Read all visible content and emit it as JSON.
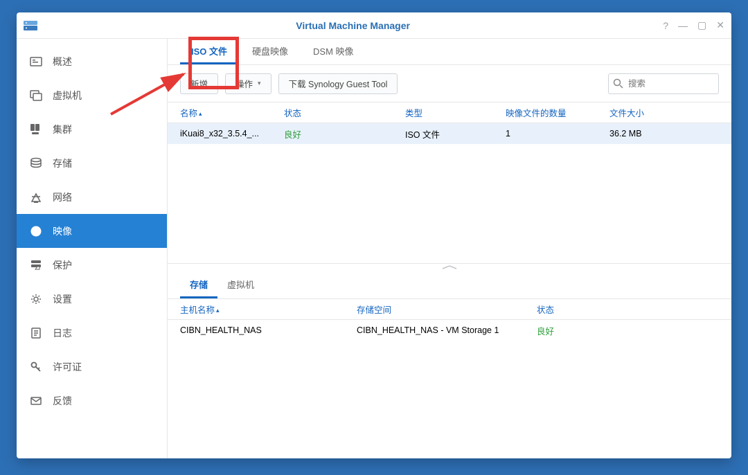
{
  "window": {
    "title": "Virtual Machine Manager"
  },
  "sidebar": {
    "items": [
      {
        "label": "概述"
      },
      {
        "label": "虚拟机"
      },
      {
        "label": "集群"
      },
      {
        "label": "存储"
      },
      {
        "label": "网络"
      },
      {
        "label": "映像"
      },
      {
        "label": "保护"
      },
      {
        "label": "设置"
      },
      {
        "label": "日志"
      },
      {
        "label": "许可证"
      },
      {
        "label": "反馈"
      }
    ]
  },
  "tabs": {
    "items": [
      {
        "label": "ISO 文件"
      },
      {
        "label": "硬盘映像"
      },
      {
        "label": "DSM 映像"
      }
    ]
  },
  "toolbar": {
    "add": "新增",
    "ops": "操作",
    "download": "下载 Synology Guest Tool",
    "search_placeholder": "搜索"
  },
  "grid": {
    "headers": {
      "name": "名称",
      "status": "状态",
      "type": "类型",
      "count": "映像文件的数量",
      "size": "文件大小"
    },
    "rows": [
      {
        "name": "iKuai8_x32_3.5.4_...",
        "status": "良好",
        "type": "ISO 文件",
        "count": "1",
        "size": "36.2 MB"
      }
    ]
  },
  "lower": {
    "tabs": [
      {
        "label": "存储"
      },
      {
        "label": "虚拟机"
      }
    ],
    "headers": {
      "host": "主机名称",
      "space": "存储空间",
      "status": "状态"
    },
    "rows": [
      {
        "host": "CIBN_HEALTH_NAS",
        "space": "CIBN_HEALTH_NAS - VM Storage 1",
        "status": "良好"
      }
    ]
  }
}
